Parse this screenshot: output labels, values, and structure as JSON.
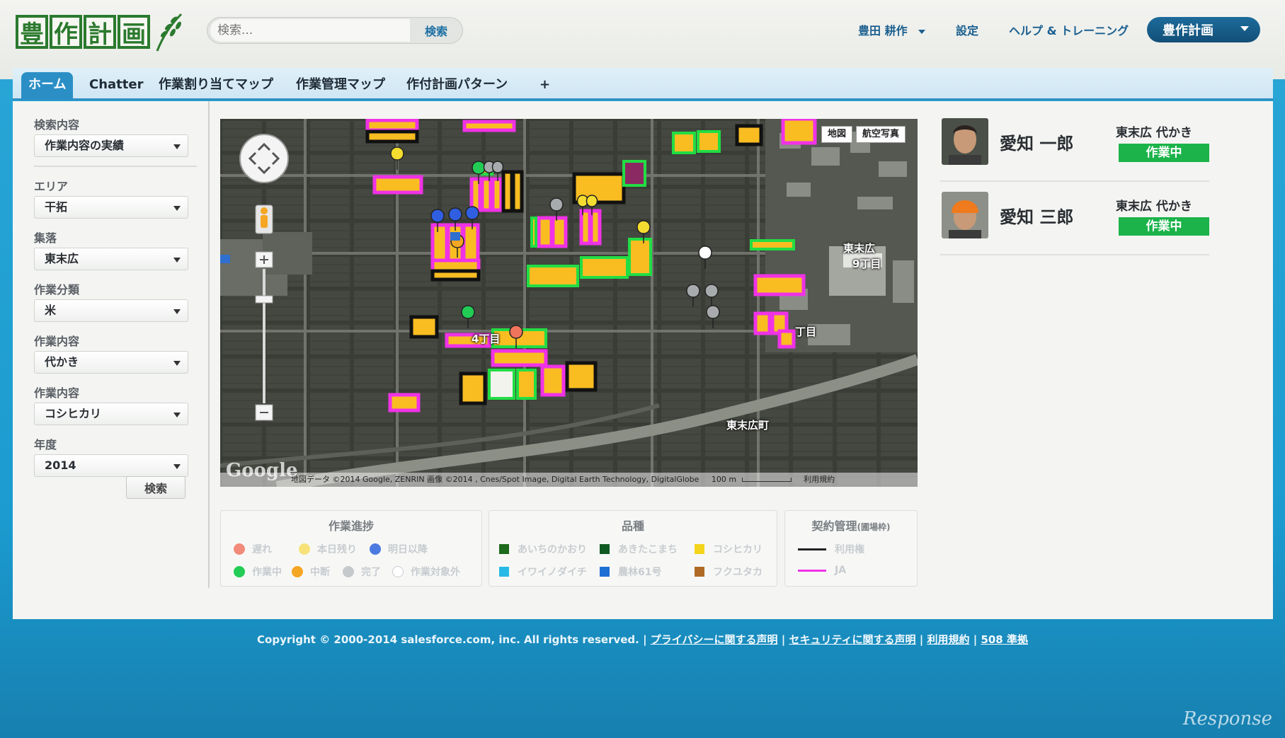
{
  "header": {
    "logo_chars": [
      "豊",
      "作",
      "計",
      "画"
    ],
    "search_placeholder": "検索...",
    "search_button": "検索",
    "user_menu": "豊田 耕作",
    "settings": "設定",
    "help": "ヘルプ & トレーニング",
    "app_switcher": "豊作計画"
  },
  "tabs": [
    {
      "label": "ホーム",
      "active": true
    },
    {
      "label": "Chatter",
      "active": false
    },
    {
      "label": "作業割り当てマップ",
      "active": false
    },
    {
      "label": "作業管理マップ",
      "active": false
    },
    {
      "label": "作付計画パターン",
      "active": false
    },
    {
      "label": "+",
      "active": false
    }
  ],
  "filters": [
    {
      "label": "検索内容",
      "value": "作業内容の実績"
    },
    {
      "label": "エリア",
      "value": "干拓"
    },
    {
      "label": "集落",
      "value": "東末広"
    },
    {
      "label": "作業分類",
      "value": "米"
    },
    {
      "label": "作業内容",
      "value": "代かき"
    },
    {
      "label": "作業内容",
      "value": "コシヒカリ"
    },
    {
      "label": "年度",
      "value": "2014"
    }
  ],
  "sidebar_search_button": "検索",
  "map": {
    "type_map": "地図",
    "type_satellite": "航空写真",
    "labels": [
      "東末広",
      "9丁目",
      "4丁目",
      "丁目",
      "東末広町"
    ],
    "google": "Google",
    "attribution": "地図データ ©2014 Google, ZENRIN 画像 ©2014 , Cnes/Spot Image, Digital Earth Technology, DigitalGlobe",
    "scale": "100 m",
    "terms": "利用規約"
  },
  "legend_progress": {
    "title": "作業進捗",
    "items": [
      {
        "label": "遅れ",
        "color": "#f28b7a"
      },
      {
        "label": "本日残り",
        "color": "#f7e27a"
      },
      {
        "label": "明日以降",
        "color": "#4b7be0"
      },
      {
        "label": "作業中",
        "color": "#22cc55"
      },
      {
        "label": "中断",
        "color": "#f5a623"
      },
      {
        "label": "完了",
        "color": "#c6c9cc"
      },
      {
        "label": "作業対象外",
        "color": "#ffffff"
      }
    ]
  },
  "legend_variety": {
    "title": "品種",
    "items": [
      {
        "label": "あいちのかおり",
        "color": "#1d6b1d"
      },
      {
        "label": "あきたこまち",
        "color": "#0f5a22"
      },
      {
        "label": "コシヒカリ",
        "color": "#f4d41a"
      },
      {
        "label": "イワイノダイチ",
        "color": "#29b9e6"
      },
      {
        "label": "農林61号",
        "color": "#1d6fd4"
      },
      {
        "label": "フクユタカ",
        "color": "#b06a25"
      }
    ]
  },
  "legend_contract": {
    "title": "契約管理",
    "subtitle": "(圃場枠)",
    "items": [
      {
        "label": "利用権",
        "color": "#222222"
      },
      {
        "label": "JA",
        "color": "#f032e6"
      }
    ]
  },
  "workers": [
    {
      "name": "愛知 一郎",
      "area": "東末広 代かき",
      "status": "作業中"
    },
    {
      "name": "愛知 三郎",
      "area": "東末広 代かき",
      "status": "作業中"
    }
  ],
  "footer": {
    "copyright": "Copyright © 2000-2014 salesforce.com, inc. All rights reserved. | ",
    "links": [
      "プライバシーに関する声明",
      "セキュリティに関する声明",
      "利用規約",
      "508 準拠"
    ]
  },
  "watermark": "Response"
}
